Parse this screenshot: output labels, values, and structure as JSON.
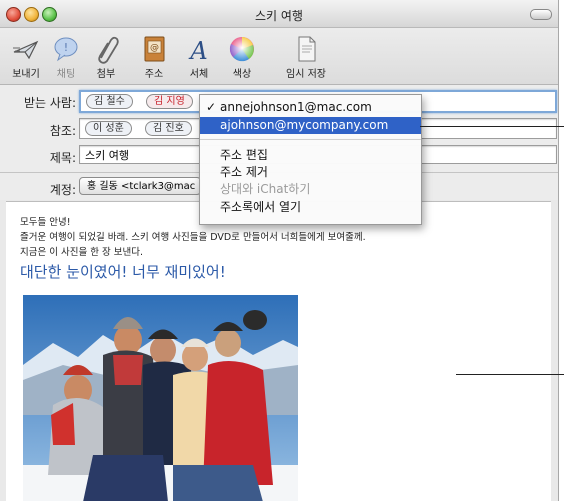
{
  "window": {
    "title": "스키 여행"
  },
  "toolbar": [
    {
      "id": "send",
      "label": "보내기",
      "icon": "send-icon",
      "dim": false
    },
    {
      "id": "chat",
      "label": "채팅",
      "icon": "chat-icon",
      "dim": true
    },
    {
      "id": "attach",
      "label": "첨부",
      "icon": "paperclip-icon",
      "dim": false
    },
    {
      "id": "address",
      "label": "주소",
      "icon": "address-book-icon",
      "dim": false
    },
    {
      "id": "fonts",
      "label": "서체",
      "icon": "font-icon",
      "dim": false
    },
    {
      "id": "colors",
      "label": "색상",
      "icon": "color-wheel-icon",
      "dim": false
    },
    {
      "id": "draft",
      "label": "임시 저장",
      "icon": "draft-icon",
      "dim": false
    }
  ],
  "headers": {
    "to": {
      "label": "받는 사람:",
      "tokens": [
        {
          "name": "김 철수",
          "red": false
        },
        {
          "name": "김 지영",
          "red": true
        }
      ]
    },
    "cc": {
      "label": "참조:",
      "tokens": [
        {
          "name": "이 성훈",
          "red": false
        },
        {
          "name": "김 진호",
          "red": false
        }
      ]
    },
    "subject": {
      "label": "제목:",
      "value": "스키 여행"
    },
    "account": {
      "label": "계정:",
      "value": "홍 길동 <tclark3@mac"
    }
  },
  "menu": {
    "items": [
      {
        "label": "annejohnson1@mac.com",
        "checked": true,
        "state": "normal"
      },
      {
        "label": "ajohnson@mycompany.com",
        "checked": false,
        "state": "selected"
      },
      {
        "separator": true
      },
      {
        "label": "주소 편집",
        "checked": false,
        "state": "normal"
      },
      {
        "label": "주소 제거",
        "checked": false,
        "state": "normal"
      },
      {
        "label": "상대와 iChat하기",
        "checked": false,
        "state": "disabled"
      },
      {
        "label": "주소록에서 열기",
        "checked": false,
        "state": "normal"
      }
    ],
    "checkmark": "✓"
  },
  "message": {
    "lines": [
      "모두들 안녕!",
      "즐거운 여행이 되었길 바래. 스키 여행 사진들을 DVD로 만들어서 너희들에게 보여줄께.",
      "지금은 이 사진을 한 장 보낸다."
    ],
    "big": "대단한 눈이였어! 너무 재미있어!"
  },
  "colors": {
    "accent": "#2f62c7",
    "close": "#e2503d",
    "minimize": "#f1b43b",
    "zoom": "#5bc24a",
    "big_text": "#2c5aa8",
    "red_token": "#c8202a"
  }
}
